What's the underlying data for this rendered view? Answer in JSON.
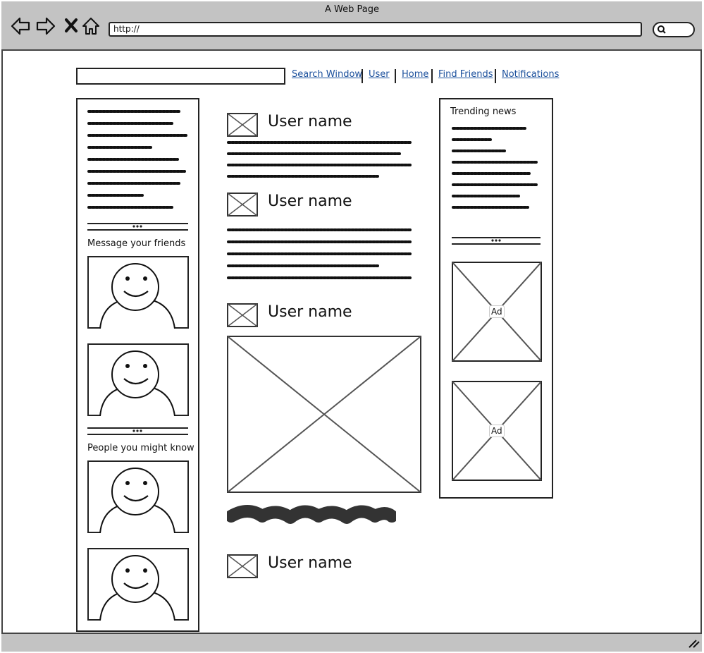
{
  "browser": {
    "title": "A Web Page",
    "url": "http://"
  },
  "nav": {
    "links": [
      "Search Window",
      "User",
      "Home",
      "Find Friends",
      "Notifications"
    ]
  },
  "left": {
    "message_title": "Message your friends",
    "people_title": "People you might know"
  },
  "feed": {
    "posts": [
      {
        "user": "User name"
      },
      {
        "user": "User name"
      },
      {
        "user": "User name"
      },
      {
        "user": "User name"
      }
    ]
  },
  "right": {
    "trending_title": "Trending news",
    "ads": [
      {
        "label": "Ad"
      },
      {
        "label": "Ad"
      }
    ]
  }
}
